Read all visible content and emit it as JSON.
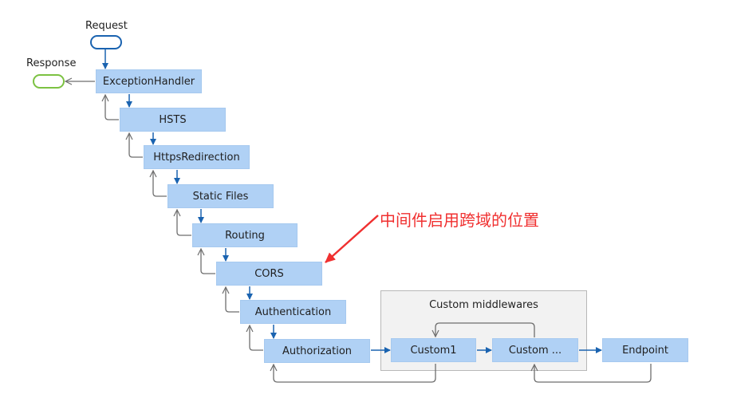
{
  "colors": {
    "box_fill": "#b0d1f5",
    "forward_arrow": "#1a63b0",
    "return_arrow": "#6e6e6e",
    "request_pill": "#1a63b0",
    "response_pill": "#7cc242",
    "annotation": "#f03030",
    "group_fill": "#f2f2f2"
  },
  "terminals": {
    "request": "Request",
    "response": "Response"
  },
  "pipeline": [
    {
      "id": "exceptionhandler",
      "label": "ExceptionHandler"
    },
    {
      "id": "hsts",
      "label": "HSTS"
    },
    {
      "id": "httpsredirection",
      "label": "HttpsRedirection"
    },
    {
      "id": "staticfiles",
      "label": "Static Files"
    },
    {
      "id": "routing",
      "label": "Routing"
    },
    {
      "id": "cors",
      "label": "CORS"
    },
    {
      "id": "authentication",
      "label": "Authentication"
    },
    {
      "id": "authorization",
      "label": "Authorization"
    }
  ],
  "custom_group": {
    "title": "Custom middlewares",
    "items": [
      {
        "id": "custom1",
        "label": "Custom1"
      },
      {
        "id": "customn",
        "label": "Custom ..."
      }
    ]
  },
  "endpoint": {
    "label": "Endpoint"
  },
  "annotation": {
    "text": "中间件启用跨域的位置",
    "target": "CORS"
  }
}
